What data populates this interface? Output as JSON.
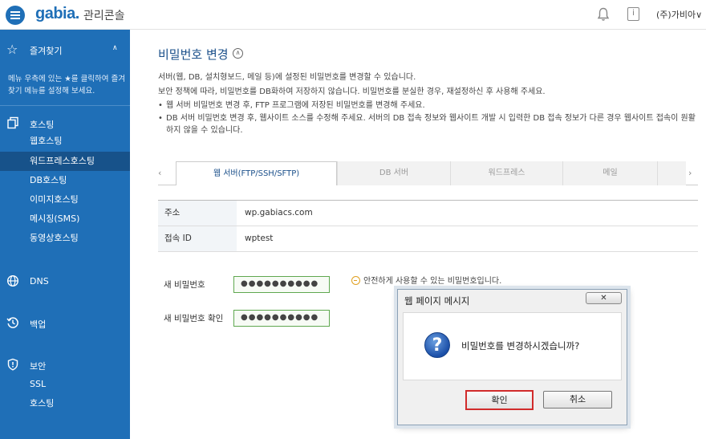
{
  "header": {
    "logo": "gabia.",
    "app_title": "관리콘솔",
    "user_menu": "(주)가비아",
    "user_chevron": "∨"
  },
  "sidebar": {
    "favorites": {
      "label": "즐겨찾기",
      "description": "메뉴 우측에 있는 ★를 클릭하여 즐겨찾기 메뉴를 설정해 보세요."
    },
    "hosting": {
      "label": "호스팅",
      "items": [
        {
          "label": "웹호스팅",
          "active": false
        },
        {
          "label": "워드프레스호스팅",
          "active": true
        },
        {
          "label": "DB호스팅",
          "active": false
        },
        {
          "label": "이미지호스팅",
          "active": false
        },
        {
          "label": "메시징(SMS)",
          "active": false
        },
        {
          "label": "동영상호스팅",
          "active": false
        }
      ]
    },
    "dns": {
      "label": "DNS"
    },
    "backup": {
      "label": "백업"
    },
    "security": {
      "label": "보안",
      "items": [
        {
          "label": "SSL"
        },
        {
          "label": "호스팅"
        }
      ]
    }
  },
  "main": {
    "title": "비밀번호 변경",
    "intro_1": "서버(웹, DB, 설치형보드, 메일 등)에 설정된 비밀번호를 변경할 수 있습니다.",
    "intro_2": "보안 정책에 따라, 비밀번호를 DB화하여 저장하지 않습니다. 비밀번호를 분실한 경우, 재설정하신 후 사용해 주세요.",
    "bullets": [
      "웹 서버 비밀번호 변경 후, FTP 프로그램에 저장된 비밀번호를 변경해 주세요.",
      "DB 서버 비밀번호 변경 후, 웹사이트 소스를 수정해 주세요. 서버의 DB 접속 정보와 웹사이트 개발 시 입력한 DB 접속 정보가 다른 경우 웹사이트 접속이 원활하지 않을 수 있습니다."
    ],
    "tabs": [
      {
        "label": "웹 서버(FTP/SSH/SFTP)",
        "active": true
      },
      {
        "label": "DB 서버",
        "active": false
      },
      {
        "label": "워드프레스",
        "active": false
      },
      {
        "label": "메일",
        "active": false
      }
    ],
    "info": [
      {
        "key": "주소",
        "value": "wp.gabiacs.com"
      },
      {
        "key": "접속 ID",
        "value": "wptest"
      }
    ],
    "new_password_label": "새 비밀번호",
    "new_password_value": "●●●●●●●●●●",
    "confirm_password_label": "새 비밀번호 확인",
    "confirm_password_value": "●●●●●●●●●●",
    "password_status": "안전하게 사용할 수 있는 비밀번호입니다."
  },
  "dialog": {
    "title": "웹 페이지 메시지",
    "message": "비밀번호를 변경하시겠습니까?",
    "ok": "확인",
    "cancel": "취소"
  }
}
